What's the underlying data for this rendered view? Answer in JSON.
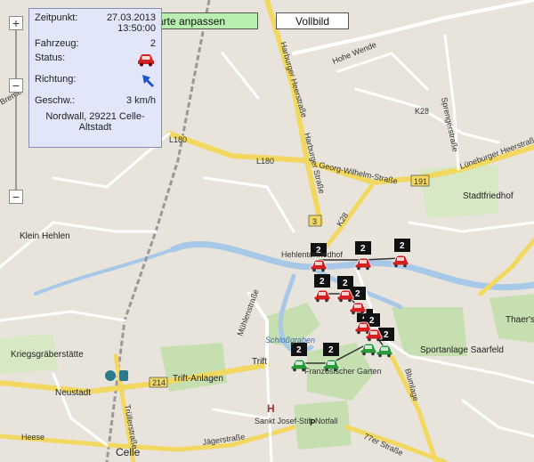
{
  "toolbar": {
    "fit_label": "arte anpassen",
    "full_label": "Vollbild"
  },
  "zoom": {
    "in": "+",
    "mid": "−",
    "out": "−"
  },
  "popup": {
    "time_label": "Zeitpunkt:",
    "time_value": "27.03.2013 13:50:00",
    "vehicle_label": "Fahrzeug:",
    "vehicle_value": "2",
    "status_label": "Status:",
    "direction_label": "Richtung:",
    "speed_label": "Geschw.:",
    "speed_value": "3 km/h",
    "address": "Nordwall, 29221 Celle-Altstadt"
  },
  "markers": {
    "badge_text": "2",
    "colors": {
      "stopped": "#d42020",
      "moving": "#2a9a3a"
    }
  },
  "map_labels": {
    "hohe_wende": "Hohe Wende",
    "harburger_heerstrasse": "Harburger Heerstraße",
    "harburger_strasse": "Harburger Straße",
    "l180_a": "L180",
    "l180_b": "L180",
    "georg_wilhelm": "Georg-Wilhelm-Straße",
    "k28": "K28",
    "k28_b": "K28",
    "sprengerstrasse": "Sprengerstraße",
    "lueneburger": "Lüneburger Heerstraße",
    "stadtfriedhof": "Stadtfriedhof",
    "route_191": "191",
    "route_3": "3",
    "klein_hehlen": "Klein Hehlen",
    "hehlentor": "Hehlentorfriedhof",
    "muehlenstrasse": "Mühlenstraße",
    "schlossgraben": "Schloßgraben",
    "kriegsgraeberstaette": "Kriegsgräberstätte",
    "trift": "Trift",
    "trift_anlagen": "Trift-Anlagen",
    "route_214": "214",
    "neustadt": "Neustadt",
    "franz_garten": "Französischer Garten",
    "sportanlage": "Sportanlage Saarfeld",
    "blumlage": "Blumlage",
    "thaers": "Thaer's Garten",
    "trullerstrasse": "Trüllerstraße",
    "sankt_josef": "Sankt Josef-Stift Notfall",
    "heese": "Heese",
    "jaegerstrasse": "Jägerstraße",
    "celle": "Celle",
    "tor_strasse": "77er Straße",
    "bremer": "Bremer",
    "h_sign": "H",
    "p_sign": "P"
  }
}
